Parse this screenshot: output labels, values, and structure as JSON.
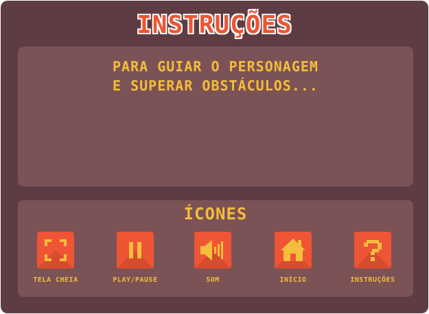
{
  "title": "INSTRUÇÕES",
  "instructions": {
    "line1": "PARA GUIAR O PERSONAGEM",
    "line2": "E SUPERAR OBSTÁCULOS..."
  },
  "icons_panel": {
    "heading": "ÍCONES",
    "items": [
      {
        "label": "TELA CHEIA",
        "icon": "fullscreen-icon"
      },
      {
        "label": "PLAY/PAUSE",
        "icon": "pause-icon"
      },
      {
        "label": "SOM",
        "icon": "speaker-icon"
      },
      {
        "label": "INÍCIO",
        "icon": "home-icon"
      },
      {
        "label": "INSTRUÇÕES",
        "icon": "question-icon"
      }
    ]
  },
  "colors": {
    "background": "#5e3c43",
    "panel": "#7b5255",
    "accent_text": "#f4bd3c",
    "button": "#ee5535",
    "title": "#ef5532"
  }
}
